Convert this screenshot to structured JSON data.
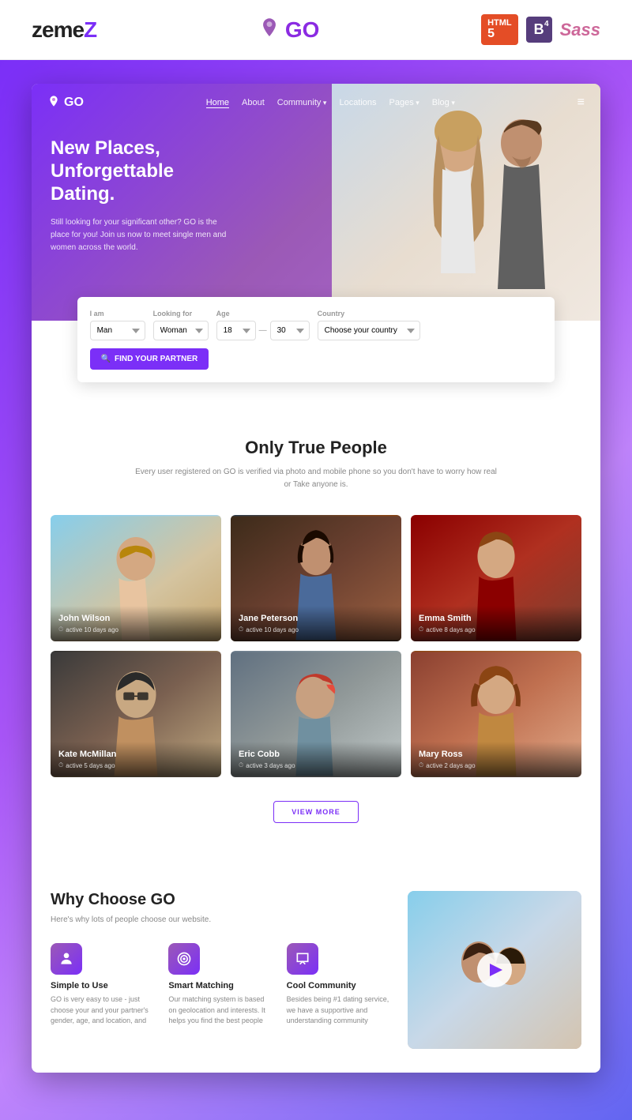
{
  "topbar": {
    "logo_zemes": "zemeZ",
    "logo_go": "GO",
    "badge_html": "HTML5",
    "badge_b": "B",
    "badge_b_sup": "4",
    "badge_sass": "Sass"
  },
  "nav": {
    "logo": "GO",
    "links": [
      {
        "label": "Home",
        "active": true
      },
      {
        "label": "About",
        "active": false
      },
      {
        "label": "Community",
        "active": false,
        "has_arrow": true
      },
      {
        "label": "Locations",
        "active": false
      },
      {
        "label": "Pages",
        "active": false,
        "has_arrow": true
      },
      {
        "label": "Blog",
        "active": false,
        "has_arrow": true
      }
    ]
  },
  "hero": {
    "title": "New Places, Unforgettable Dating.",
    "description": "Still looking for your significant other? GO is the place for you! Join us now to meet single men and women across the world."
  },
  "search": {
    "i_am_label": "I am",
    "i_am_value": "Man",
    "looking_for_label": "Looking for",
    "looking_for_value": "Woman",
    "age_label": "Age",
    "age_from": "18",
    "age_to": "30",
    "country_label": "Country",
    "country_placeholder": "Choose your country",
    "button_label": "FIND YOUR PARTNER"
  },
  "people_section": {
    "title": "Only True People",
    "description": "Every user registered on GO is verified via photo and mobile phone so you don't have to worry how real or Take anyone is.",
    "cards": [
      {
        "name": "John Wilson",
        "status": "active 10 days ago",
        "color_class": "card-john"
      },
      {
        "name": "Jane Peterson",
        "status": "active 10 days ago",
        "color_class": "card-jane"
      },
      {
        "name": "Emma Smith",
        "status": "active 8 days ago",
        "color_class": "card-emma"
      },
      {
        "name": "Kate McMillan",
        "status": "active 5 days ago",
        "color_class": "card-kate"
      },
      {
        "name": "Eric Cobb",
        "status": "active 3 days ago",
        "color_class": "card-eric"
      },
      {
        "name": "Mary Ross",
        "status": "active 2 days ago",
        "color_class": "card-mary"
      }
    ],
    "view_more_button": "VIEW MORE"
  },
  "why_section": {
    "title": "Why Choose GO",
    "subtitle": "Here's why lots of people choose our website.",
    "features": [
      {
        "icon": "👤",
        "title": "Simple to Use",
        "description": "GO is very easy to use - just choose your and your partner's gender, age, and location, and"
      },
      {
        "icon": "🎯",
        "title": "Smart Matching",
        "description": "Our matching system is based on geolocation and interests. It helps you find the best people"
      },
      {
        "icon": "💬",
        "title": "Cool Community",
        "description": "Besides being #1 dating service, we have a supportive and understanding community"
      }
    ]
  }
}
